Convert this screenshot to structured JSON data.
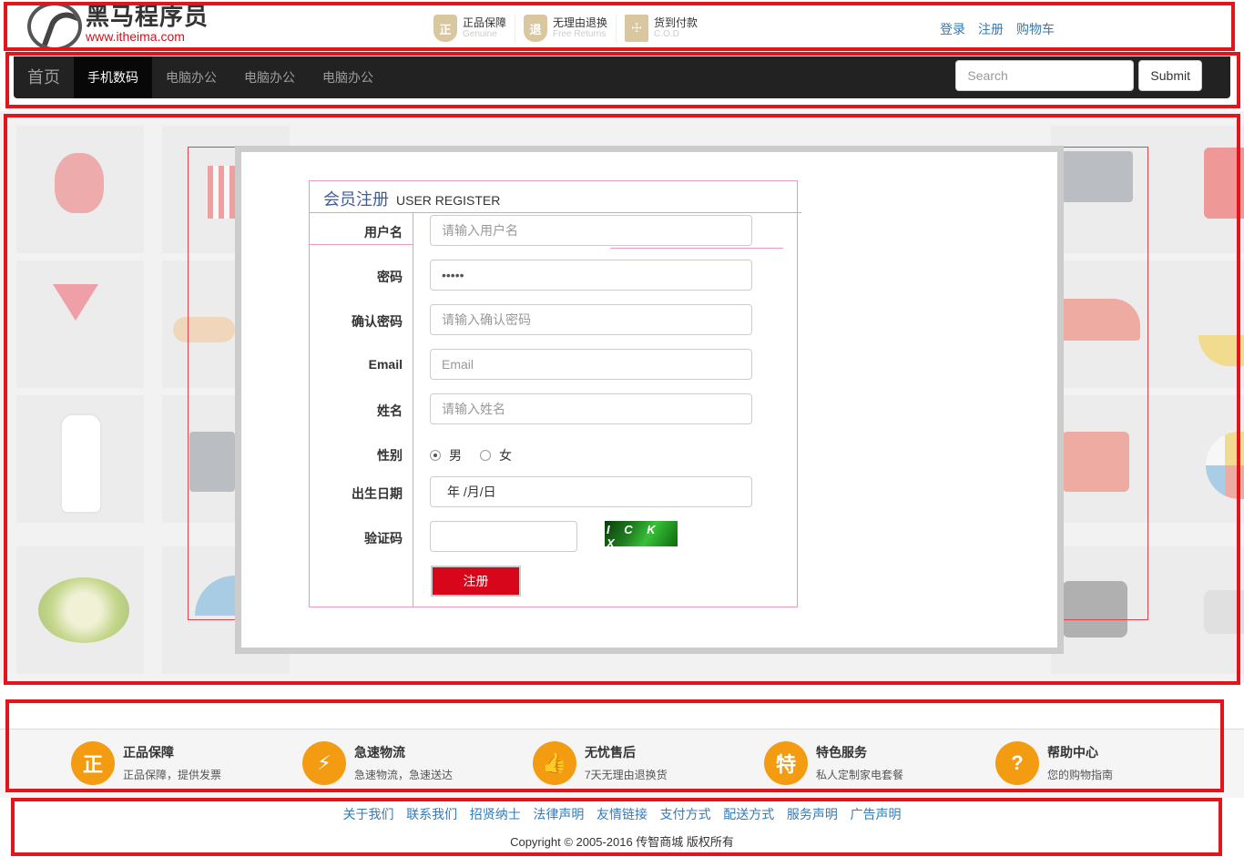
{
  "header": {
    "logo_cn": "黑马程序员",
    "logo_url": "www.itheima.com",
    "promises": [
      {
        "icon": "正",
        "title": "正品保障",
        "subtitle": "Genuine"
      },
      {
        "icon": "退",
        "title": "无理由退换",
        "subtitle": "Free Returns"
      },
      {
        "icon": "☩",
        "title": "货到付款",
        "subtitle": "C.O.D"
      }
    ],
    "links": [
      "登录",
      "注册",
      "购物车"
    ]
  },
  "navbar": {
    "brand": "首页",
    "items": [
      "手机数码",
      "电脑办公",
      "电脑办公",
      "电脑办公"
    ],
    "search_placeholder": "Search",
    "submit_label": "Submit"
  },
  "form": {
    "title_cn": "会员注册",
    "title_en": "USER REGISTER",
    "fields": {
      "username": {
        "label": "用户名",
        "placeholder": "请输入用户名",
        "value": ""
      },
      "password": {
        "label": "密码",
        "value": "•••••"
      },
      "confirm": {
        "label": "确认密码",
        "placeholder": "请输入确认密码"
      },
      "email": {
        "label": "Email",
        "placeholder": "Email"
      },
      "name": {
        "label": "姓名",
        "placeholder": "请输入姓名"
      },
      "gender": {
        "label": "性别",
        "options": [
          "男",
          "女"
        ],
        "selected": "男"
      },
      "birthday": {
        "label": "出生日期",
        "value": "年 /月/日"
      },
      "captcha": {
        "label": "验证码",
        "image_text": "I C K X"
      }
    },
    "submit_label": "注册"
  },
  "services": [
    {
      "icon": "正",
      "title": "正品保障",
      "subtitle": "正品保障，提供发票"
    },
    {
      "icon": "⚡",
      "title": "急速物流",
      "subtitle": "急速物流，急速送达"
    },
    {
      "icon": "👍",
      "title": "无忧售后",
      "subtitle": "7天无理由退换货"
    },
    {
      "icon": "特",
      "title": "特色服务",
      "subtitle": "私人定制家电套餐"
    },
    {
      "icon": "?",
      "title": "帮助中心",
      "subtitle": "您的购物指南"
    }
  ],
  "footer": {
    "links": [
      "关于我们",
      "联系我们",
      "招贤纳士",
      "法律声明",
      "友情链接",
      "支付方式",
      "配送方式",
      "服务声明",
      "广告声明"
    ],
    "copyright": "Copyright © 2005-2016 传智商城 版权所有"
  },
  "colors": {
    "accent_red": "#d7061b",
    "annotation_red": "#e3141b",
    "nav_bg": "#222222",
    "link_blue": "#337ab7",
    "service_orange": "#f39c12"
  }
}
